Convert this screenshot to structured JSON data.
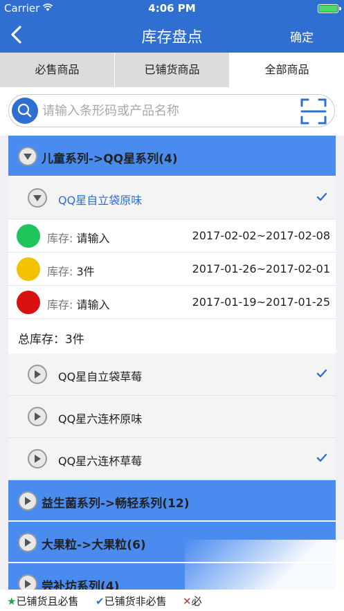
{
  "status": {
    "carrier": "Carrier",
    "time": "4:06 PM"
  },
  "nav": {
    "title": "库存盘点",
    "confirm": "确定"
  },
  "tabs": [
    "必售商品",
    "已铺货商品",
    "全部商品"
  ],
  "search": {
    "placeholder": "请输入条形码或产品名称"
  },
  "groups": [
    {
      "label": "儿童系列->QQ星系列(4)"
    },
    {
      "label": "益生菌系列->畅轻系列(12)"
    },
    {
      "label": "大果粒->大果粒(6)"
    },
    {
      "label": "尝补坊系列(4)"
    }
  ],
  "products": [
    {
      "name": "QQ星自立袋原味",
      "checked": true
    },
    {
      "name": "QQ星自立袋草莓",
      "checked": true
    },
    {
      "name": "QQ星六连杯原味",
      "checked": false
    },
    {
      "name": "QQ星六连杯草莓",
      "checked": true
    }
  ],
  "stock_rows": [
    {
      "color": "#1fc45a",
      "label": "库存:",
      "value": "请输入",
      "range": "2017-02-02~2017-02-08"
    },
    {
      "color": "#f2c200",
      "label": "库存:",
      "value": "3件",
      "range": "2017-01-26~2017-02-01"
    },
    {
      "color": "#d81010",
      "label": "库存:",
      "value": "请输入",
      "range": "2017-01-19~2017-01-25"
    }
  ],
  "total": {
    "label": "总库存：",
    "value": "3件"
  },
  "legend": [
    {
      "icon": "star-icon",
      "text": "已铺货且必售",
      "color": "#1aa64a"
    },
    {
      "icon": "check-icon",
      "text": "已铺货非必售",
      "color": "#2f6fd1"
    },
    {
      "icon": "x-icon",
      "text": "必",
      "color": "#d03030"
    }
  ],
  "colors": {
    "primary": "#2f6fd1",
    "group": "#4a8bf0"
  }
}
